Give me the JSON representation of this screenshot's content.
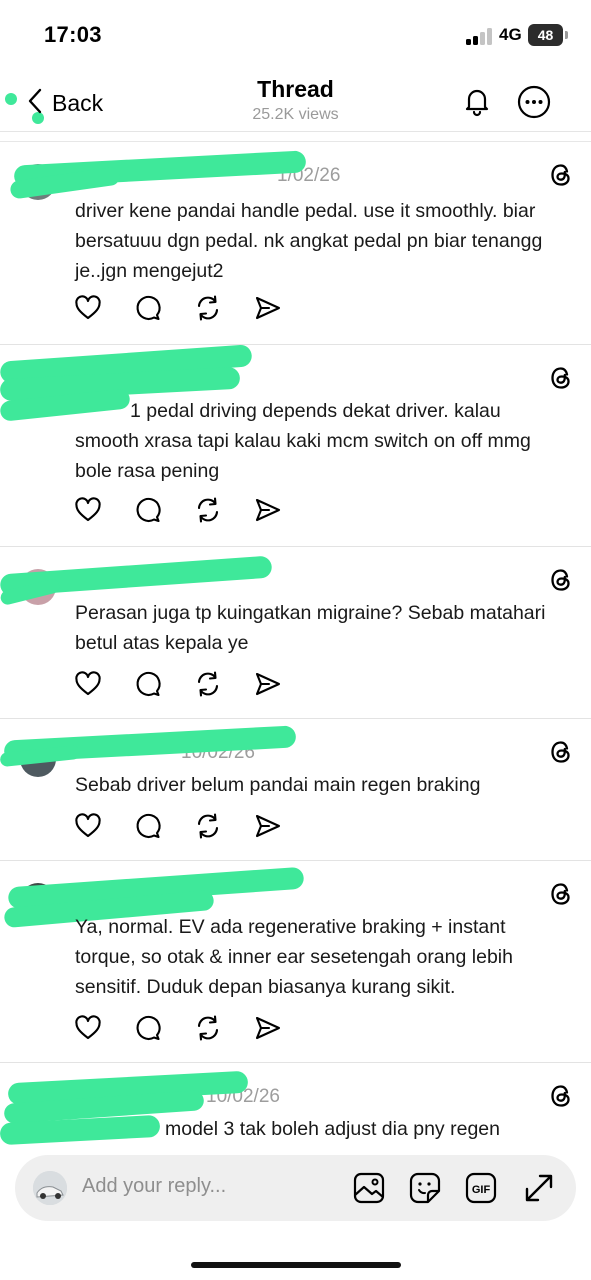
{
  "status": {
    "time": "17:03",
    "network": "4G",
    "battery": "48"
  },
  "nav": {
    "back_label": "Back",
    "title": "Thread",
    "views": "25.2K views"
  },
  "posts": [
    {
      "meta": "1/02/26",
      "text": "driver kene pandai handle pedal. use it smoothly. biar bersatuuu dgn pedal. nk angkat pedal pn biar tenangg je..jgn mengejut2"
    },
    {
      "meta": "",
      "text": "1 pedal driving depends dekat driver. kalau smooth xrasa tapi kalau kaki mcm switch on off mmg bole rasa pening"
    },
    {
      "meta": "",
      "text": "Perasan juga tp kuingatkan migraine? Sebab matahari betul atas kepala ye"
    },
    {
      "meta": "10/02/26",
      "text": "Sebab driver belum pandai main regen braking"
    },
    {
      "meta": "",
      "text": "Ya, normal. EV ada regenerative braking + instant torque, so otak & inner ear sesetengah orang lebih sensitif. Duduk depan biasanya kurang sikit."
    },
    {
      "meta": "10/02/26",
      "text": "model 3 tak boleh adjust dia pny regen"
    }
  ],
  "reply": {
    "placeholder": "Add your reply..."
  },
  "colors": {
    "redaction": "#3fe89a",
    "meta_gray": "#9d9d9d",
    "reply_bg": "#efefef"
  },
  "icons": [
    "chevron-left-icon",
    "bell-icon",
    "more-icon",
    "threads-logo-icon",
    "heart-icon",
    "comment-icon",
    "repost-icon",
    "share-icon",
    "image-icon",
    "sticker-icon",
    "gif-icon",
    "expand-icon"
  ]
}
